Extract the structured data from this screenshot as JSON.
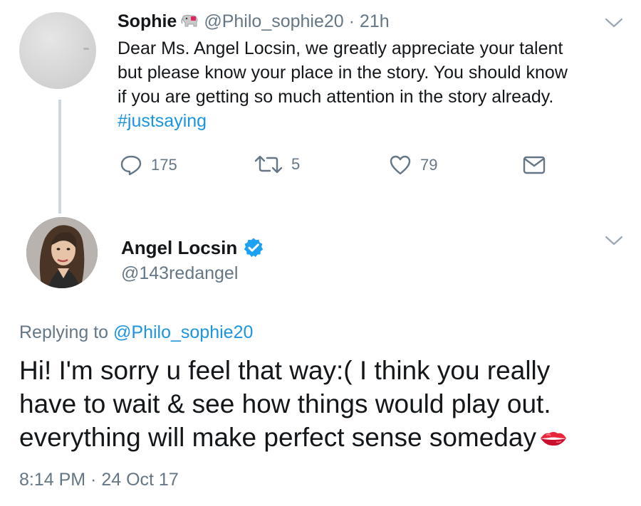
{
  "first_tweet": {
    "author_name": "Sophie",
    "author_handle": "@Philo_sophie20",
    "separator": " · ",
    "time_ago": "21h",
    "text_lines": [
      "Dear Ms. Angel Locsin, we greatly appreciate your talent",
      "but please know your place in the story. You should know",
      "if you are getting so much attention in the story already."
    ],
    "hashtag": "#justsaying",
    "actions": {
      "reply_count": "175",
      "retweet_count": "5",
      "like_count": "79"
    }
  },
  "second_tweet": {
    "author_name": "Angel Locsin",
    "author_handle": "@143redangel",
    "replying_prefix": "Replying to ",
    "replying_to": "@Philo_sophie20",
    "text_lines": [
      "Hi! I'm sorry u feel that way:( I think you really",
      "have to wait & see how things would play out.",
      "everything will make perfect sense someday"
    ],
    "timestamp": "8:14 PM · 24 Oct 17"
  },
  "icons": [
    "elephant-emoji-icon",
    "chevron-down-icon",
    "reply-icon",
    "retweet-icon",
    "like-icon",
    "direct-message-icon",
    "verified-badge-icon",
    "kiss-mark-emoji-icon"
  ],
  "colors": {
    "link_blue": "#1b95e0",
    "secondary_gray": "#657786",
    "primary_text": "#14171a",
    "thread_line": "#ccd6dd"
  }
}
